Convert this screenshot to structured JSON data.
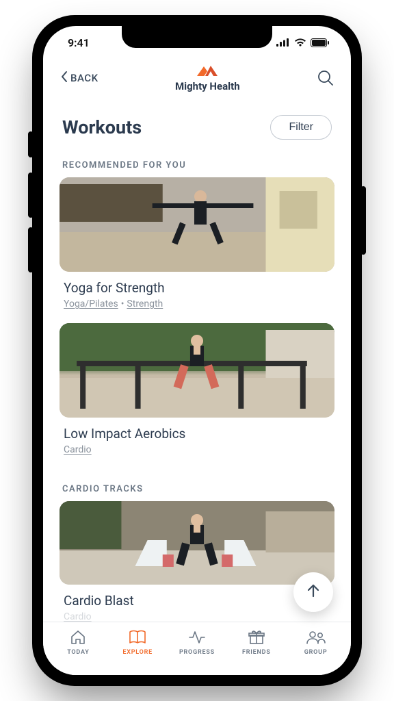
{
  "status": {
    "time": "9:41"
  },
  "nav": {
    "back_label": "BACK",
    "brand_name": "Mighty Health"
  },
  "page": {
    "title": "Workouts",
    "filter_label": "Filter"
  },
  "sections": {
    "recommended": {
      "label": "RECOMMENDED FOR YOU",
      "items": [
        {
          "title": "Yoga for Strength",
          "tags": [
            "Yoga/Pilates",
            "Strength"
          ]
        },
        {
          "title": "Low Impact Aerobics",
          "tags": [
            "Cardio"
          ]
        }
      ]
    },
    "cardio": {
      "label": "CARDIO TRACKS",
      "items": [
        {
          "title": "Cardio Blast",
          "tags": [
            "Cardio"
          ]
        }
      ]
    }
  },
  "tabs": {
    "today": "TODAY",
    "explore": "EXPLORE",
    "progress": "PROGRESS",
    "friends": "FRIENDS",
    "group": "GROUP",
    "active": "explore"
  },
  "colors": {
    "text_primary": "#2b3a4e",
    "text_secondary": "#6a7684",
    "accent": "#f26a2a"
  }
}
